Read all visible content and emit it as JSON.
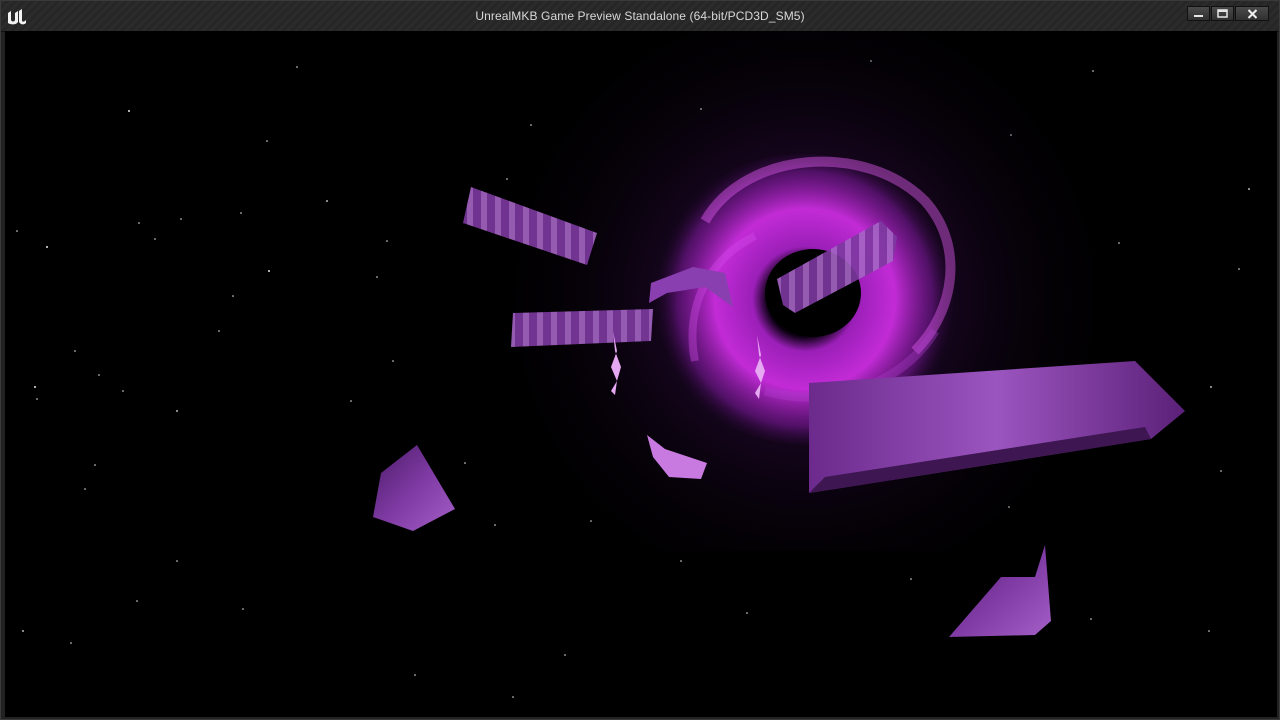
{
  "window": {
    "title": "UnrealMKB Game Preview Standalone (64-bit/PCD3D_SM5)",
    "logo_icon": "unreal-engine-logo-icon",
    "controls": {
      "minimize_icon": "minimize-icon",
      "maximize_icon": "maximize-icon",
      "close_icon": "close-icon"
    }
  },
  "scene": {
    "description_icons": [
      "black-hole-vortex",
      "space-debris",
      "spaceship"
    ],
    "colors": {
      "background": "#000000",
      "vortex": "#c22bd6",
      "debris": "#7a2e9c",
      "debris_highlight": "#b46ad0"
    }
  }
}
